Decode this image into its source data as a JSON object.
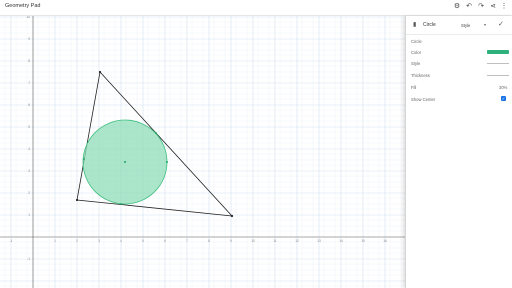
{
  "app": {
    "title": "Geometry Pad"
  },
  "toolbar": {
    "settings_icon": "⚙",
    "undo_icon": "↶",
    "redo_icon": "↷",
    "share_icon": "⋖",
    "more_icon": "⋮"
  },
  "axes": {
    "x_ticks": [
      "-1",
      "1",
      "2",
      "3",
      "4",
      "5",
      "6",
      "7",
      "8",
      "9",
      "10",
      "11",
      "12",
      "13",
      "14",
      "15",
      "16"
    ],
    "y_ticks": [
      "10",
      "9",
      "8",
      "7",
      "6",
      "5",
      "4",
      "3",
      "2",
      "1",
      "-1"
    ]
  },
  "shapes": {
    "triangle_color": "#222222",
    "circle_fill": "#8fdcb8",
    "circle_stroke": "#3fbf7f",
    "point_color": "#1aa566"
  },
  "panel": {
    "header_icon": "▮",
    "title": "Circle",
    "style_label": "Style",
    "caret": "▾",
    "check_icon": "✓",
    "section_label": "Circle",
    "rows": {
      "color_label": "Color",
      "color_value": "#2eb07a",
      "style_label": "Style",
      "thickness_label": "Thickness",
      "fill_label": "Fill",
      "fill_value": "30%",
      "show_center_label": "Show Center",
      "show_center_checked": true
    }
  }
}
